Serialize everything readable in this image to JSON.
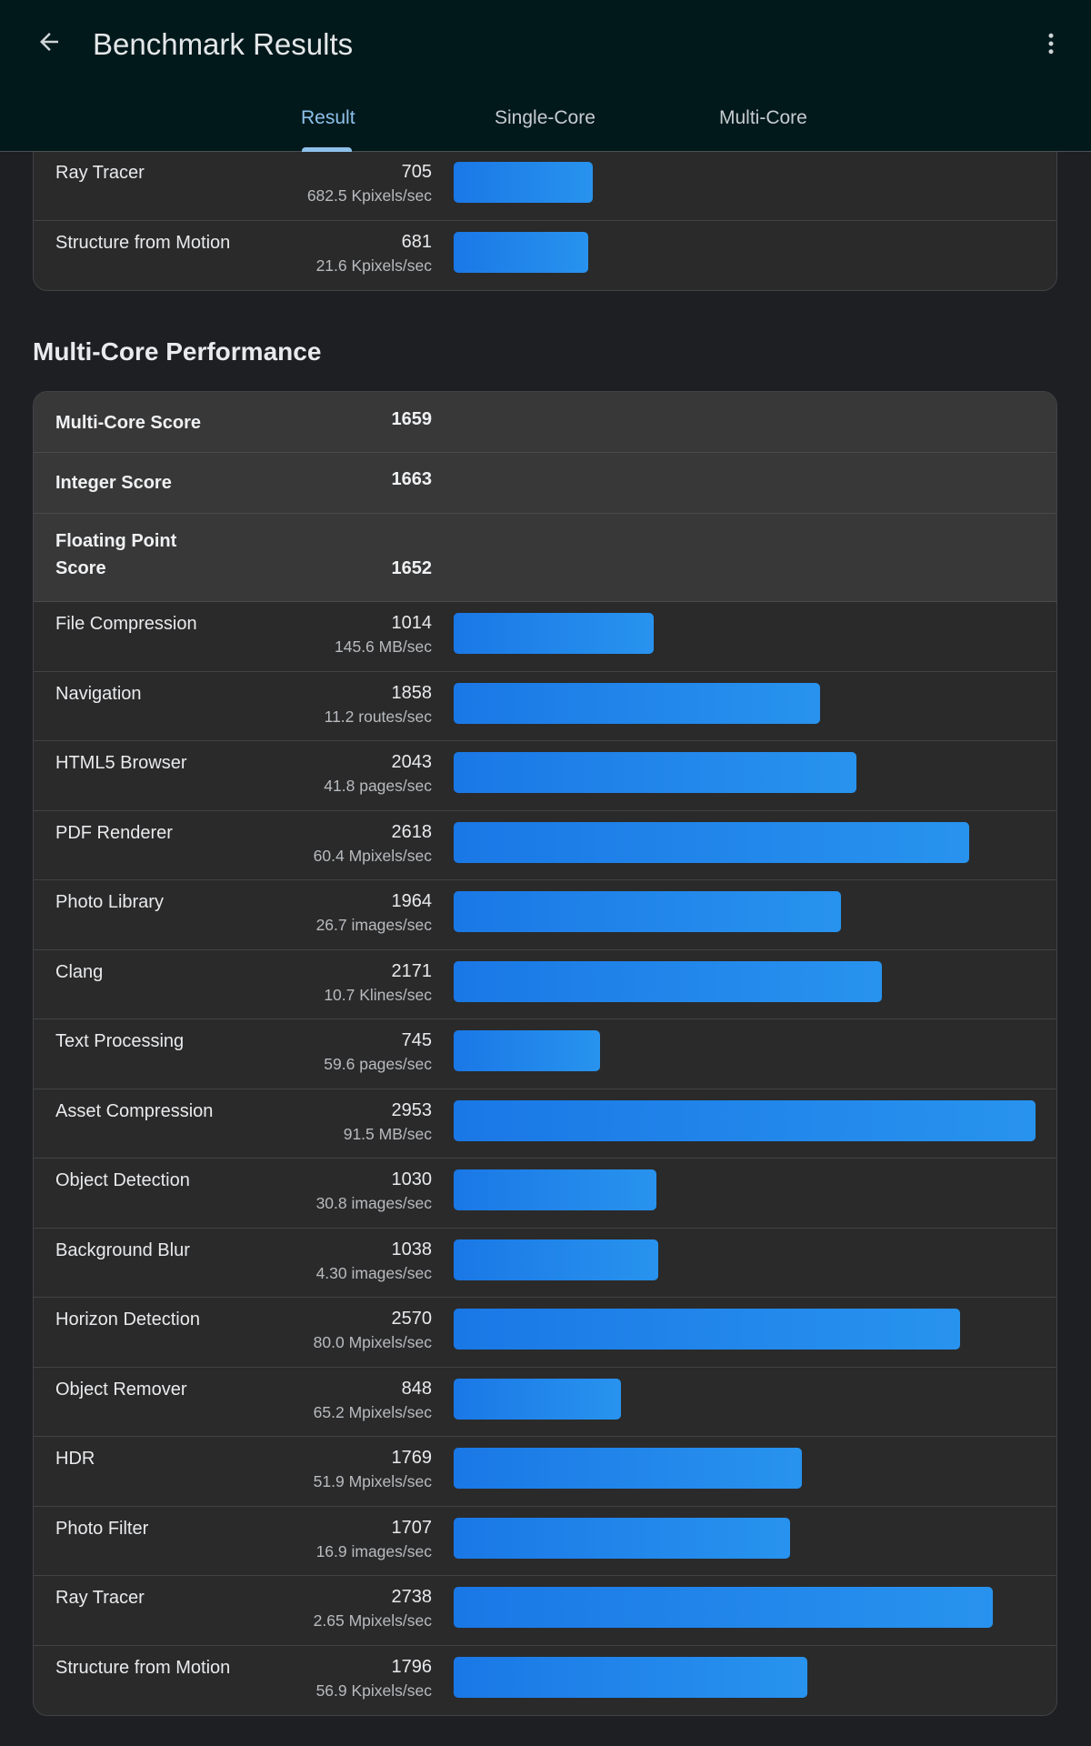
{
  "header": {
    "title": "Benchmark Results",
    "tabs": [
      {
        "label": "Result",
        "active": true
      },
      {
        "label": "Single-Core",
        "active": false
      },
      {
        "label": "Multi-Core",
        "active": false
      }
    ],
    "icons": [
      "arrow-back-icon",
      "more-vert-icon"
    ]
  },
  "colors": {
    "appbar": "#02191c",
    "background": "#1e1f22",
    "card": "#2a2a2b",
    "bar": "#1a78e6",
    "tab_active": "#8ec1ea"
  },
  "single_core_tail": [
    {
      "name": "Ray Tracer",
      "score": "705",
      "sub": "682.5 Kpixels/sec",
      "value": 705
    },
    {
      "name": "Structure from Motion",
      "score": "681",
      "sub": "21.6 Kpixels/sec",
      "value": 681
    }
  ],
  "multi_core": {
    "title": "Multi-Core Performance",
    "summary": [
      {
        "label": "Multi-Core Score",
        "score": "1659"
      },
      {
        "label": "Integer Score",
        "score": "1663"
      },
      {
        "label": "Floating Point Score",
        "score": "1652"
      }
    ],
    "rows": [
      {
        "name": "File Compression",
        "score": "1014",
        "sub": "145.6 MB/sec",
        "value": 1014
      },
      {
        "name": "Navigation",
        "score": "1858",
        "sub": "11.2 routes/sec",
        "value": 1858
      },
      {
        "name": "HTML5 Browser",
        "score": "2043",
        "sub": "41.8 pages/sec",
        "value": 2043
      },
      {
        "name": "PDF Renderer",
        "score": "2618",
        "sub": "60.4 Mpixels/sec",
        "value": 2618
      },
      {
        "name": "Photo Library",
        "score": "1964",
        "sub": "26.7 images/sec",
        "value": 1964
      },
      {
        "name": "Clang",
        "score": "2171",
        "sub": "10.7 Klines/sec",
        "value": 2171
      },
      {
        "name": "Text Processing",
        "score": "745",
        "sub": "59.6 pages/sec",
        "value": 745
      },
      {
        "name": "Asset Compression",
        "score": "2953",
        "sub": "91.5 MB/sec",
        "value": 2953
      },
      {
        "name": "Object Detection",
        "score": "1030",
        "sub": "30.8 images/sec",
        "value": 1030
      },
      {
        "name": "Background Blur",
        "score": "1038",
        "sub": "4.30 images/sec",
        "value": 1038
      },
      {
        "name": "Horizon Detection",
        "score": "2570",
        "sub": "80.0 Mpixels/sec",
        "value": 2570
      },
      {
        "name": "Object Remover",
        "score": "848",
        "sub": "65.2 Mpixels/sec",
        "value": 848
      },
      {
        "name": "HDR",
        "score": "1769",
        "sub": "51.9 Mpixels/sec",
        "value": 1769
      },
      {
        "name": "Photo Filter",
        "score": "1707",
        "sub": "16.9 images/sec",
        "value": 1707
      },
      {
        "name": "Ray Tracer",
        "score": "2738",
        "sub": "2.65 Mpixels/sec",
        "value": 2738
      },
      {
        "name": "Structure from Motion",
        "score": "1796",
        "sub": "56.9 Kpixels/sec",
        "value": 1796
      }
    ]
  }
}
